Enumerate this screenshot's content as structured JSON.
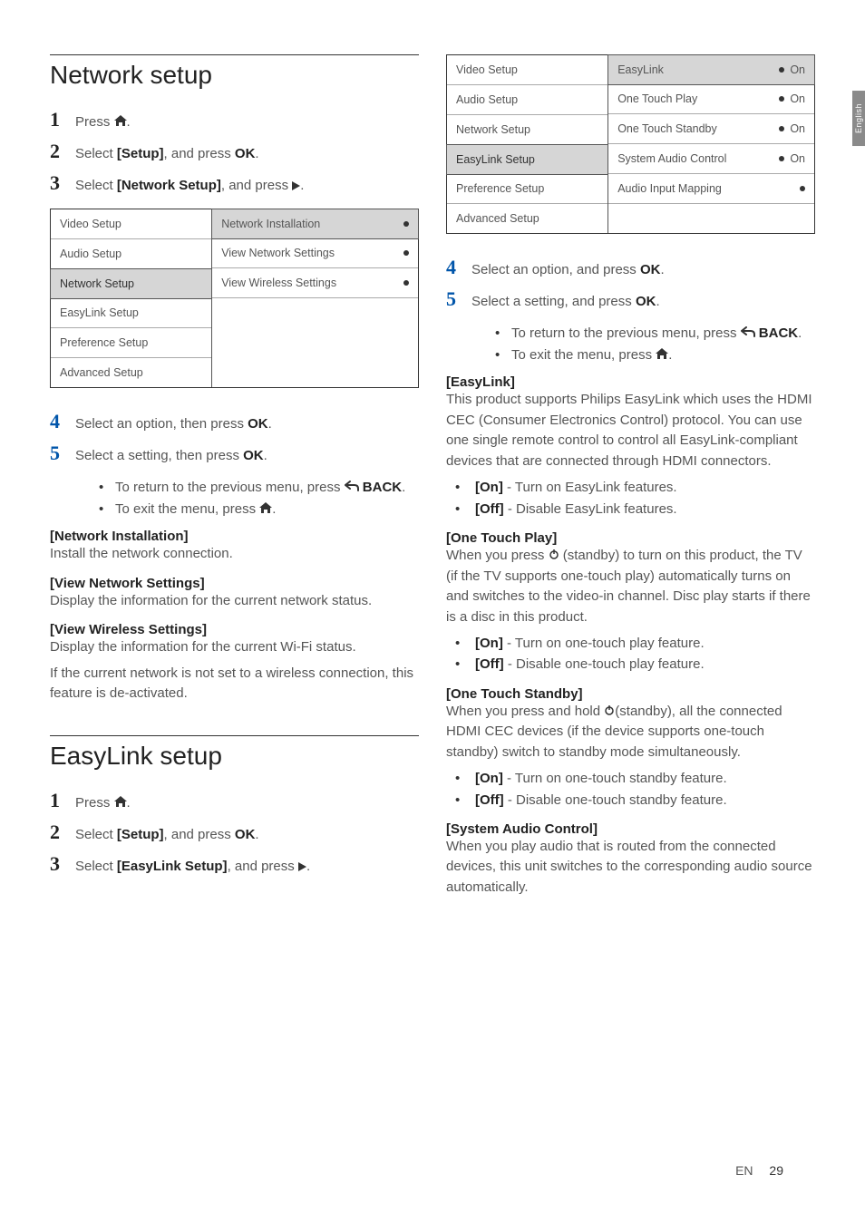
{
  "sideTab": "English",
  "footer": {
    "lang": "EN",
    "page": "29"
  },
  "left": {
    "networkSetup": {
      "title": "Network setup",
      "steps": {
        "s1_a": "Press ",
        "s2_a": "Select ",
        "s2_b": "[Setup]",
        "s2_c": ", and press ",
        "s2_ok": "OK",
        "s2_d": ".",
        "s3_a": "Select ",
        "s3_b": "[Network Setup]",
        "s3_c": ", and press ",
        "s4_a": "Select an option, then press ",
        "s4_ok": "OK",
        "s4_b": ".",
        "s5_a": "Select a setting, then press ",
        "s5_ok": "OK",
        "s5_b": "."
      },
      "sub": {
        "ret": "To return to the previous menu, press ",
        "back": " BACK",
        "exit": "To exit the menu, press "
      },
      "menu": {
        "left": [
          "Video Setup",
          "Audio Setup",
          "Network Setup",
          "EasyLink Setup",
          "Preference Setup",
          "Advanced Setup"
        ],
        "selectedLeft": 2,
        "right": [
          {
            "label": "Network Installation",
            "value": "",
            "selected": true
          },
          {
            "label": "View Network Settings",
            "value": ""
          },
          {
            "label": "View Wireless Settings",
            "value": ""
          }
        ]
      },
      "sections": {
        "ni_h": "[Network Installation]",
        "ni_t": "Install the network connection.",
        "vns_h": "[View Network Settings]",
        "vns_t": "Display the information for the current network status.",
        "vws_h": "[View Wireless Settings]",
        "vws_t1": "Display the information for the current Wi-Fi status.",
        "vws_t2": "If the current network is not set to a wireless connection, this feature is de-activated."
      }
    },
    "easyLinkSetup": {
      "title": "EasyLink setup",
      "steps": {
        "s1_a": "Press ",
        "s2_a": "Select ",
        "s2_b": "[Setup]",
        "s2_c": ", and press ",
        "s2_ok": "OK",
        "s2_d": ".",
        "s3_a": "Select ",
        "s3_b": "[EasyLink Setup]",
        "s3_c": ", and press "
      }
    }
  },
  "right": {
    "menu": {
      "left": [
        "Video Setup",
        "Audio Setup",
        "Network Setup",
        "EasyLink Setup",
        "Preference Setup",
        "Advanced Setup"
      ],
      "selectedLeft": 3,
      "right": [
        {
          "label": "EasyLink",
          "value": "On",
          "selected": true
        },
        {
          "label": "One Touch Play",
          "value": "On"
        },
        {
          "label": "One Touch Standby",
          "value": "On"
        },
        {
          "label": "System Audio Control",
          "value": "On"
        },
        {
          "label": "Audio Input Mapping",
          "value": ""
        }
      ]
    },
    "steps": {
      "s4_a": "Select an option, and press ",
      "s4_ok": "OK",
      "s4_b": ".",
      "s5_a": "Select a setting, and press ",
      "s5_ok": "OK",
      "s5_b": "."
    },
    "sub": {
      "ret": "To return to the previous menu, press ",
      "back": " BACK",
      "exit": "To exit the menu, press "
    },
    "easylink": {
      "h": "[EasyLink]",
      "t": "This product supports Philips EasyLink which uses the HDMI CEC (Consumer Electronics Control) protocol. You can use one single remote control to control all EasyLink-compliant devices that are connected through HDMI connectors.",
      "on_b": "[On]",
      "on_t": " - Turn on EasyLink features.",
      "off_b": "[Off]",
      "off_t": " - Disable EasyLink features."
    },
    "otp": {
      "h": "[One Touch Play]",
      "t1": "When you press ",
      "t2": " (standby) to turn on this product, the TV (if the TV supports one-touch play) automatically turns on and switches to the video-in channel. Disc play starts if there is a disc in this product.",
      "on_b": "[On]",
      "on_t": " - Turn on one-touch play feature.",
      "off_b": "[Off]",
      "off_t": " - Disable one-touch play feature."
    },
    "ots": {
      "h": "[One Touch Standby]",
      "t1": "When you press and hold ",
      "t2": "(standby), all the connected HDMI CEC devices (if the device supports one-touch standby) switch to standby mode simultaneously.",
      "on_b": "[On]",
      "on_t": " - Turn on one-touch standby feature.",
      "off_b": "[Off]",
      "off_t": " - Disable one-touch standby feature."
    },
    "sac": {
      "h": "[System Audio Control]",
      "t": "When you play audio that is routed from the connected devices, this unit switches to the corresponding audio source automatically."
    }
  }
}
